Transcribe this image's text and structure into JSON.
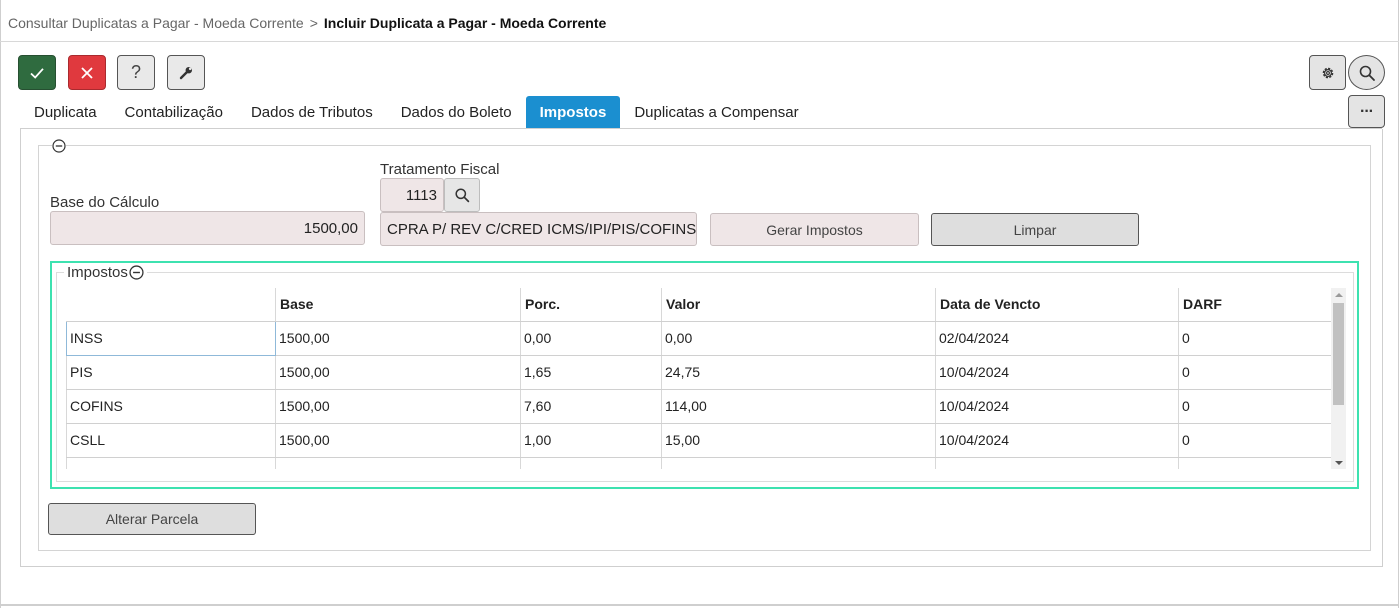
{
  "breadcrumb": {
    "parent": "Consultar Duplicatas a Pagar - Moeda Corrente",
    "separator": ">",
    "current": "Incluir Duplicata a Pagar - Moeda Corrente"
  },
  "toolbar": {
    "confirm": "check-icon",
    "cancel": "close-icon",
    "help_label": "?",
    "tools": "wrench-icon",
    "settings": "gear-icon",
    "search": "search-icon",
    "more_label": "···"
  },
  "tabs": [
    {
      "label": "Duplicata",
      "active": false
    },
    {
      "label": "Contabilização",
      "active": false
    },
    {
      "label": "Dados de Tributos",
      "active": false
    },
    {
      "label": "Dados do Boleto",
      "active": false
    },
    {
      "label": "Impostos",
      "active": true
    },
    {
      "label": "Duplicatas a Compensar",
      "active": false
    }
  ],
  "form": {
    "base_calculo_label": "Base do Cálculo",
    "base_calculo_value": "1500,00",
    "tratamento_label": "Tratamento Fiscal",
    "tratamento_code": "1113",
    "tratamento_desc": "CPRA P/ REV C/CRED ICMS/IPI/PIS/COFINS - IR",
    "gerar_label": "Gerar Impostos",
    "limpar_label": "Limpar",
    "alterar_label": "Alterar Parcela"
  },
  "impostos": {
    "legend": "Impostos",
    "columns": [
      "",
      "Base",
      "Porc.",
      "Valor",
      "Data de Vencto",
      "DARF"
    ],
    "rows": [
      [
        "INSS",
        "1500,00",
        "0,00",
        "0,00",
        "02/04/2024",
        "0"
      ],
      [
        "PIS",
        "1500,00",
        "1,65",
        "24,75",
        "10/04/2024",
        "0"
      ],
      [
        "COFINS",
        "1500,00",
        "7,60",
        "114,00",
        "10/04/2024",
        "0"
      ],
      [
        "CSLL",
        "1500,00",
        "1,00",
        "15,00",
        "10/04/2024",
        "0"
      ]
    ]
  },
  "colors": {
    "accent_tab": "#1b8fd0",
    "confirm": "#2f6b3f",
    "cancel": "#e0393e",
    "highlight_border": "#3de2b0"
  }
}
